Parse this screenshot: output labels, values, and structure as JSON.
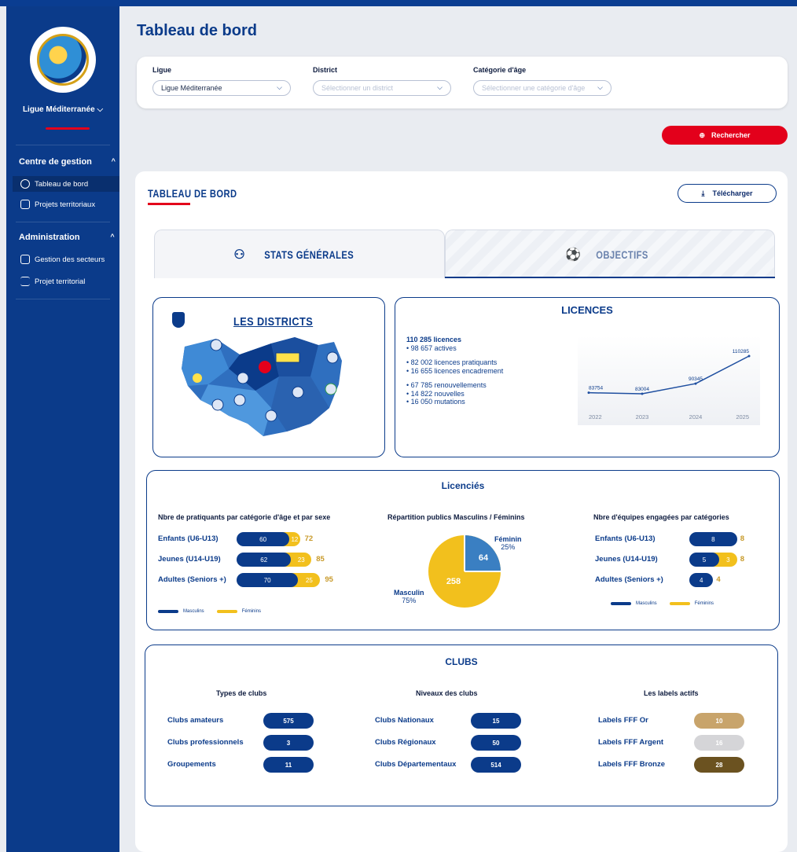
{
  "sidebar": {
    "league_label": "Ligue Méditerranée",
    "sections": [
      {
        "title": "Centre de gestion",
        "items": [
          "Tableau de bord",
          "Projets territoriaux"
        ]
      },
      {
        "title": "Administration",
        "items": [
          "Gestion des secteurs",
          "Projet territorial"
        ]
      }
    ]
  },
  "header": {
    "title": "Tableau de bord"
  },
  "filters": {
    "ligue": {
      "label": "Ligue",
      "value": "Ligue Méditerranée"
    },
    "district": {
      "label": "District",
      "placeholder": "Sélectionner un district"
    },
    "categorie": {
      "label": "Catégorie d'âge",
      "placeholder": "Sélectionner une catégorie d'âge"
    },
    "search_label": "Rechercher"
  },
  "dashboard": {
    "title": "TABLEAU DE BORD",
    "download_label": "Télécharger",
    "tabs": [
      {
        "label": "STATS GÉNÉRALES",
        "active": true
      },
      {
        "label": "OBJECTIFS",
        "active": false
      }
    ]
  },
  "districts": {
    "title": "LES DISTRICTS"
  },
  "licences": {
    "title": "LICENCES",
    "lines": [
      {
        "text": "110 285 licences",
        "bold": true
      },
      {
        "text": "• 98 657 actives"
      },
      {
        "gap": true
      },
      {
        "text": "• 82 002 licences pratiquants"
      },
      {
        "text": "• 16 655 licences encadrement"
      },
      {
        "gap": true
      },
      {
        "text": "• 67 785 renouvellements"
      },
      {
        "text": "• 14 822 nouvelles"
      },
      {
        "text": "• 16 050 mutations"
      }
    ]
  },
  "chart_data": {
    "type": "line",
    "x": [
      "2022",
      "2023",
      "2024",
      "2025"
    ],
    "series": [
      {
        "values": [
          83754,
          83004,
          90345,
          110285
        ],
        "labels": [
          "83754",
          "83004",
          "90345",
          "110285"
        ]
      }
    ],
    "color": "#1f4fa0"
  },
  "licencies": {
    "title": "Licenciés",
    "practitioners": {
      "title": "Nbre de pratiquants par catégorie d'âge et par sexe",
      "rows": [
        {
          "label": "Enfants (U6-U13)",
          "m": 60,
          "f": 12,
          "total": 72
        },
        {
          "label": "Jeunes (U14-U19)",
          "m": 62,
          "f": 23,
          "total": 85
        },
        {
          "label": "Adultes (Seniors +)",
          "m": 70,
          "f": 25,
          "total": 95
        }
      ],
      "legend_m": "Masculins",
      "legend_f": "Féminins"
    },
    "repartition": {
      "title": "Répartition publics Masculins / Féminins",
      "feminin_label": "Féminin",
      "feminin_pct": "25%",
      "feminin_value": 64,
      "masculin_label": "Masculin",
      "masculin_pct": "75%",
      "masculin_value": 258
    },
    "teams": {
      "title": "Nbre d'équipes engagées par catégories",
      "rows": [
        {
          "label": "Enfants (U6-U13)",
          "m": 8,
          "f": null,
          "total": 8
        },
        {
          "label": "Jeunes (U14-U19)",
          "m": 5,
          "f": 3,
          "total": 8
        },
        {
          "label": "Adultes (Seniors +)",
          "m": 4,
          "f": null,
          "total": 4
        }
      ],
      "legend_m": "Masculins",
      "legend_f": "Féminins"
    }
  },
  "clubs": {
    "title": "CLUBS",
    "columns": [
      {
        "title": "Types de clubs",
        "rows": [
          {
            "label": "Clubs amateurs",
            "value": "575",
            "color": "#0b3b8a"
          },
          {
            "label": "Clubs professionnels",
            "value": "3",
            "color": "#0b3b8a"
          },
          {
            "label": "Groupements",
            "value": "11",
            "color": "#0b3b8a"
          }
        ]
      },
      {
        "title": "Niveaux des clubs",
        "rows": [
          {
            "label": "Clubs Nationaux",
            "value": "15",
            "color": "#0b3b8a"
          },
          {
            "label": "Clubs Régionaux",
            "value": "50",
            "color": "#0b3b8a"
          },
          {
            "label": "Clubs Départementaux",
            "value": "514",
            "color": "#0b3b8a"
          }
        ]
      },
      {
        "title": "Les labels actifs",
        "rows": [
          {
            "label": "Labels FFF Or",
            "value": "10",
            "color": "#c8a46b"
          },
          {
            "label": "Labels FFF Argent",
            "value": "16",
            "color": "#d5d5d8"
          },
          {
            "label": "Labels FFF Bronze",
            "value": "28",
            "color": "#6b5220"
          }
        ]
      }
    ]
  }
}
